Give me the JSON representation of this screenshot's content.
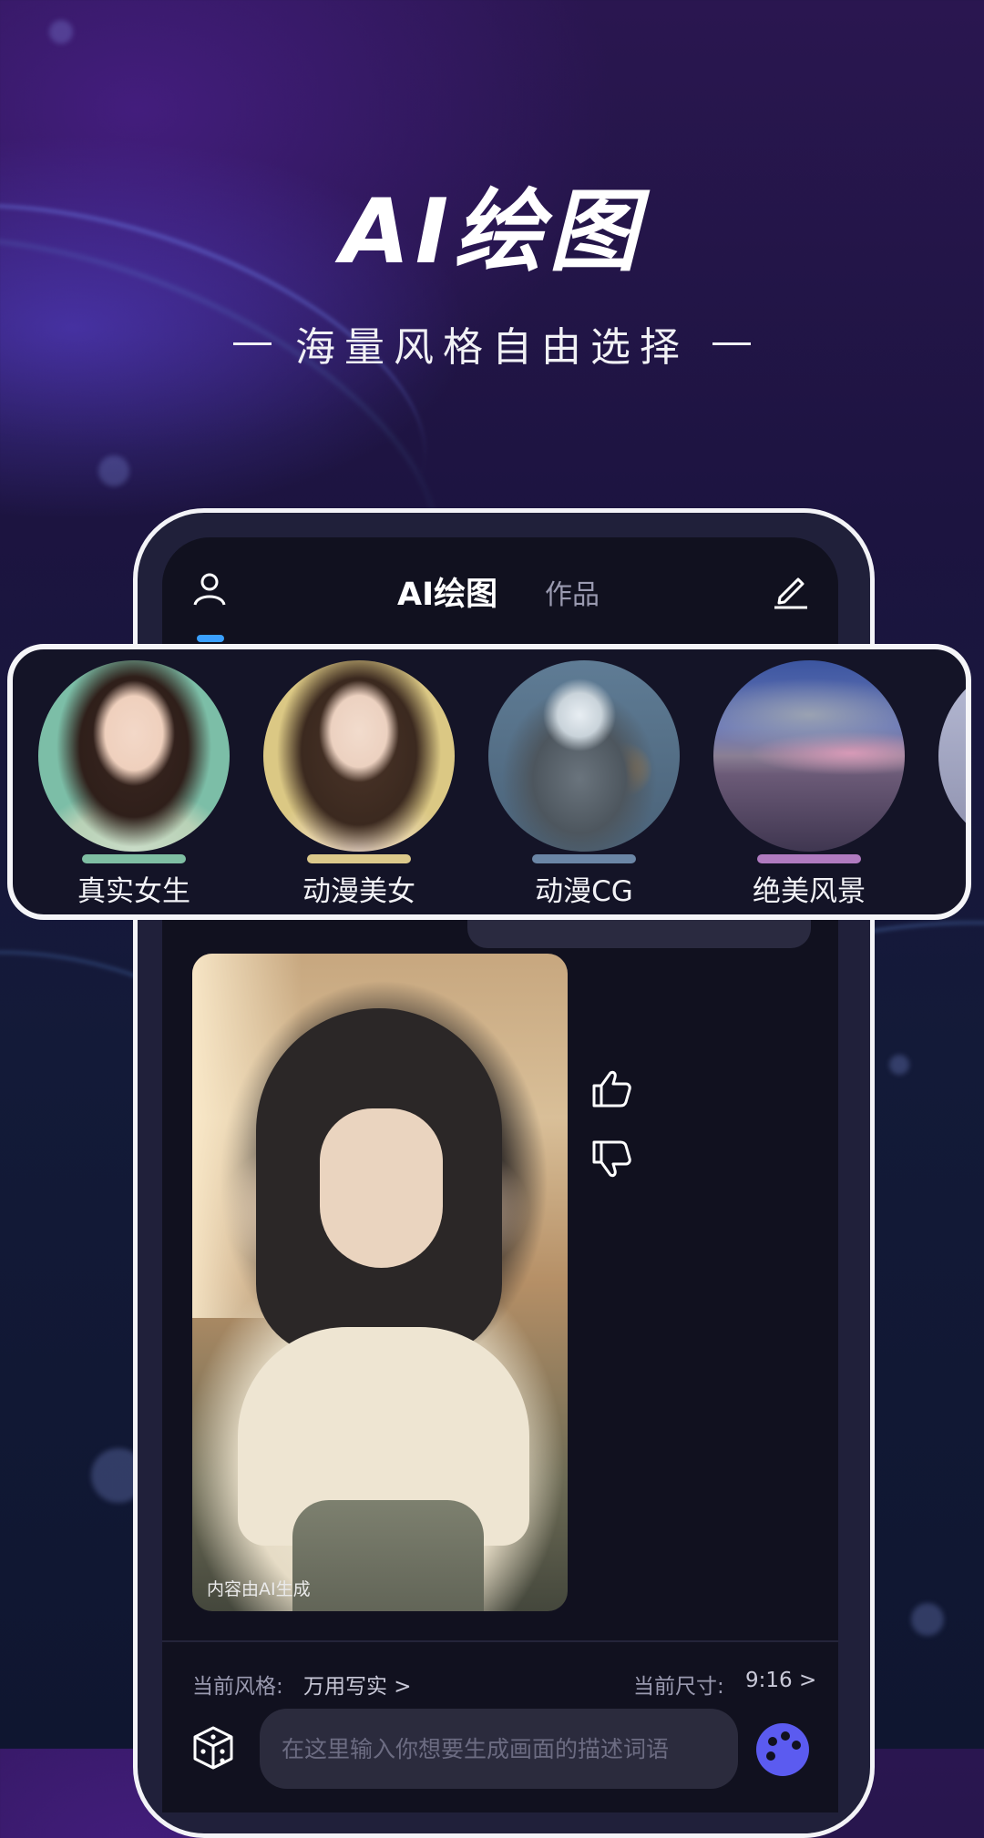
{
  "hero": {
    "title": "AI绘图",
    "subtitle": "海量风格自由选择"
  },
  "topbar": {
    "tab_active": "AI绘图",
    "tab_works": "作品"
  },
  "styles": [
    {
      "label": "真实女生",
      "underline_color": "#7fbea3"
    },
    {
      "label": "动漫美女",
      "underline_color": "#dcc98b"
    },
    {
      "label": "动漫CG",
      "underline_color": "#6b86a6"
    },
    {
      "label": "绝美风景",
      "underline_color": "#b07bc0"
    }
  ],
  "generated": {
    "caption": "内容由AI生成"
  },
  "settings": {
    "style_label": "当前风格:",
    "style_value": "万用写实 >",
    "size_label": "当前尺寸:",
    "size_value": "9:16 >"
  },
  "prompt": {
    "placeholder": "在这里输入你想要生成画面的描述词语"
  },
  "colors": {
    "accent_blue": "#3aa0ff",
    "panel_bg": "#141427",
    "paint_button": "#5b5bf0"
  }
}
